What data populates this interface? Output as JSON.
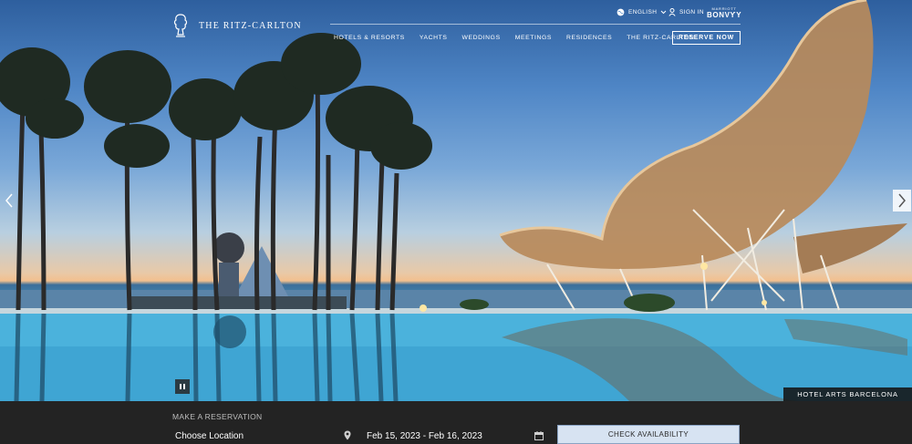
{
  "header": {
    "brand": "THE RITZ-CARLTON",
    "language": "ENGLISH",
    "sign_in": "SIGN IN",
    "bonvoy_top": "MARRIOTT",
    "bonvoy_name": "BONVƳY",
    "nav": [
      "HOTELS & RESORTS",
      "YACHTS",
      "WEDDINGS",
      "MEETINGS",
      "RESIDENCES",
      "THE RITZ-CARLTON"
    ],
    "reserve": "RESERVE NOW"
  },
  "hero": {
    "caption": "HOTEL ARTS BARCELONA"
  },
  "reservation": {
    "title": "MAKE A RESERVATION",
    "location": "Choose Location",
    "dates": "Feb 15, 2023 - Feb 16, 2023",
    "check_button": "CHECK AVAILABILITY"
  },
  "colors": {
    "bar_bg": "#232323",
    "button_bg": "#d7e3f2"
  }
}
